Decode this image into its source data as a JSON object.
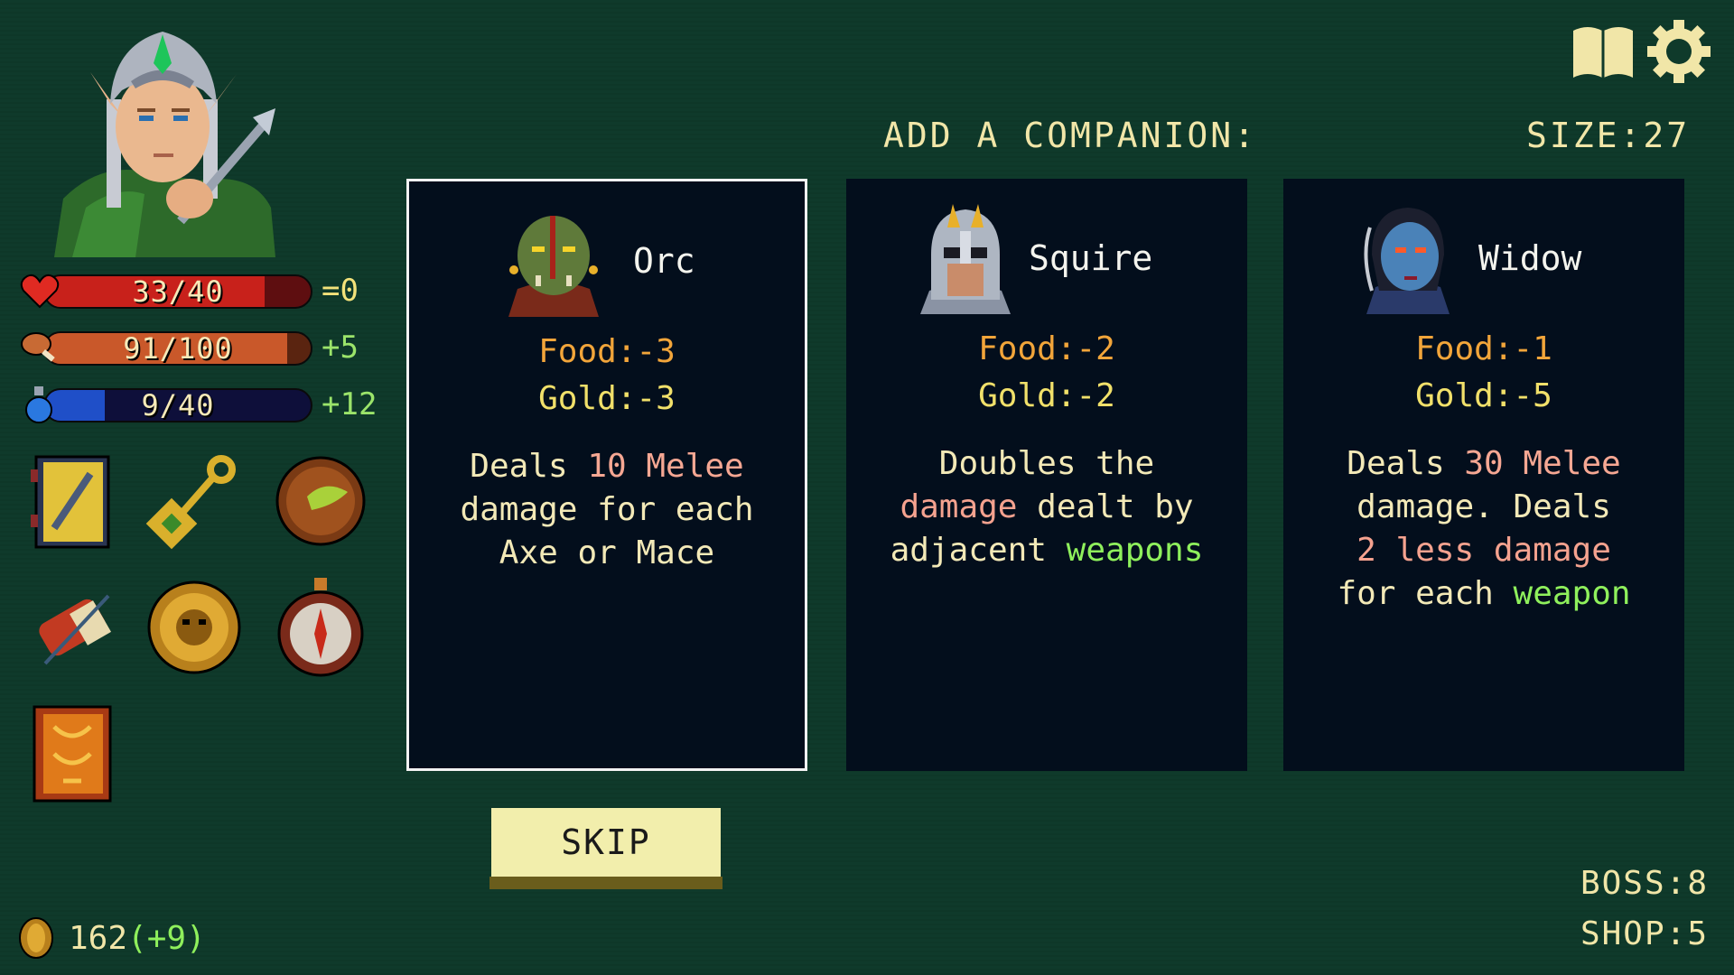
{
  "header": {
    "prompt": "ADD A COMPANION:",
    "size_label": "SIZE:",
    "size_value": "27"
  },
  "stats": {
    "health": {
      "text": "33/40",
      "current": 33,
      "max": 40,
      "delta": "=0",
      "color": "#c8211b",
      "icon": "heart-icon"
    },
    "food": {
      "text": "91/100",
      "current": 91,
      "max": 100,
      "delta": "+5",
      "color": "#c9582a",
      "icon": "drumstick-icon"
    },
    "mana": {
      "text": "9/40",
      "current": 9,
      "max": 40,
      "delta": "+12",
      "color": "#1f4fc8",
      "icon": "potion-icon"
    }
  },
  "items": [
    {
      "name": "spellbook-sword-icon"
    },
    {
      "name": "key-icon"
    },
    {
      "name": "seed-orb-icon"
    },
    {
      "name": "scroll-bundle-icon"
    },
    {
      "name": "golden-lion-shield-icon"
    },
    {
      "name": "compass-icon"
    },
    {
      "name": "rune-tome-icon"
    }
  ],
  "cards": [
    {
      "name": "Orc",
      "food_label": "Food:",
      "food": "-3",
      "gold_label": "Gold:",
      "gold": "-3",
      "desc": [
        [
          {
            "t": "Deals "
          },
          {
            "t": "10 Melee",
            "c": "num"
          }
        ],
        [
          {
            "t": "damage for each"
          }
        ],
        [
          {
            "t": "Axe or Mace"
          }
        ]
      ],
      "selected": true
    },
    {
      "name": "Squire",
      "food_label": "Food:",
      "food": "-2",
      "gold_label": "Gold:",
      "gold": "-2",
      "desc": [
        [
          {
            "t": "Doubles the"
          }
        ],
        [
          {
            "t": "damage",
            "c": "dmg"
          },
          {
            "t": " dealt by"
          }
        ],
        [
          {
            "t": "adjacent "
          },
          {
            "t": "weapons",
            "c": "weapon"
          }
        ]
      ],
      "selected": false
    },
    {
      "name": "Widow",
      "food_label": "Food:",
      "food": "-1",
      "gold_label": "Gold:",
      "gold": "-5",
      "desc": [
        [
          {
            "t": "Deals "
          },
          {
            "t": "30 Melee",
            "c": "num"
          }
        ],
        [
          {
            "t": "damage. Deals"
          }
        ],
        [
          {
            "t": "2 less damage",
            "c": "dmg"
          }
        ],
        [
          {
            "t": "for each "
          },
          {
            "t": "weapon",
            "c": "weapon"
          }
        ]
      ],
      "selected": false
    }
  ],
  "skip_label": "SKIP",
  "gold": {
    "value": "162",
    "delta": "(+9)"
  },
  "boss": {
    "label": "BOSS:",
    "value": "8"
  },
  "shop": {
    "label": "SHOP:",
    "value": "5"
  },
  "icons": {
    "journal": "open-book-icon",
    "settings": "gear-icon"
  }
}
